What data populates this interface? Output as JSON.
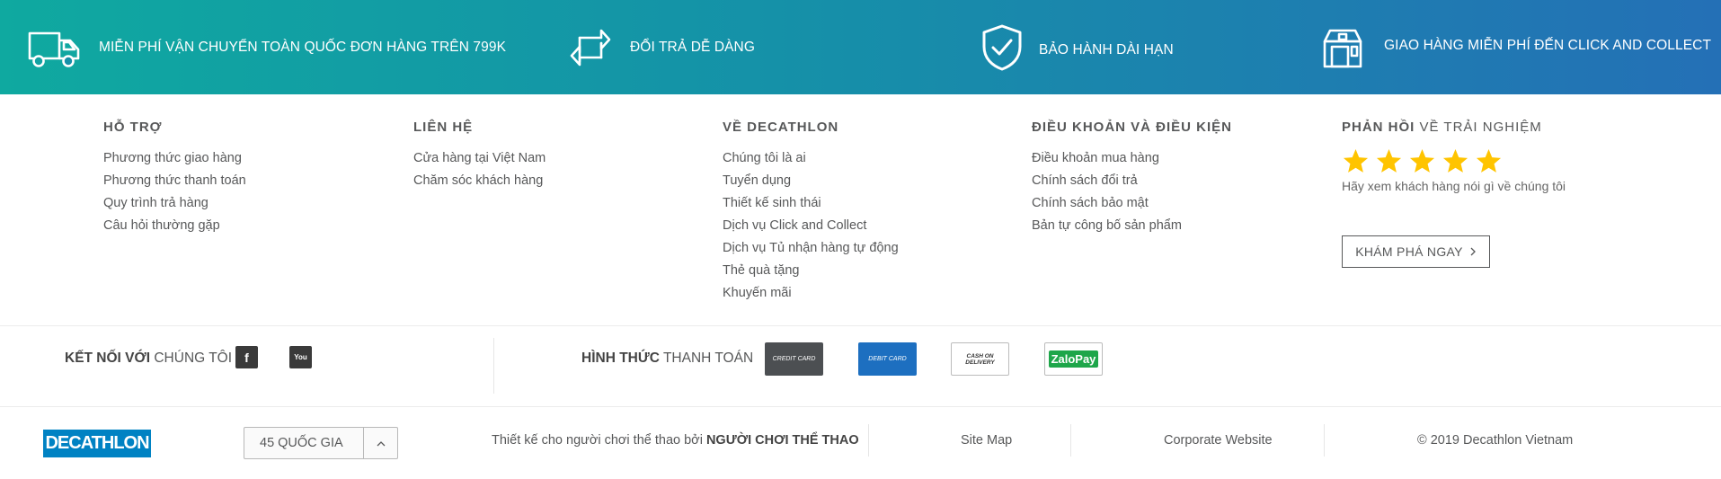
{
  "benefits": [
    {
      "icon": "truck-icon",
      "label": "MIỄN PHÍ VẬN CHUYỂN TOÀN QUỐC ĐƠN HÀNG TRÊN 799K"
    },
    {
      "icon": "exchange-icon",
      "label": "ĐỔI TRẢ DỄ DÀNG"
    },
    {
      "icon": "shield-check-icon",
      "label": "BẢO HÀNH DÀI HẠN"
    },
    {
      "icon": "store-icon",
      "label": "GIAO HÀNG MIỄN PHÍ ĐẾN CLICK AND COLLECT"
    }
  ],
  "columns": {
    "support": {
      "title": "HỖ TRỢ",
      "items": [
        "Phương thức giao hàng",
        "Phương thức thanh toán",
        "Quy trình trả hàng",
        "Câu hỏi thường gặp"
      ]
    },
    "contact": {
      "title": "LIÊN HỆ",
      "items": [
        "Cửa hàng tại Việt Nam",
        "Chăm sóc khách hàng"
      ]
    },
    "about": {
      "title": "VỀ DECATHLON",
      "items": [
        "Chúng tôi là ai",
        "Tuyển dụng",
        "Thiết kế sinh thái",
        "Dịch vụ Click and Collect",
        "Dịch vụ Tủ nhận hàng tự động",
        "Thẻ quà tặng",
        "Khuyến mãi"
      ]
    },
    "terms": {
      "title": "ĐIỀU KHOẢN VÀ ĐIỀU KIỆN",
      "items": [
        "Điều khoản mua hàng",
        "Chính sách đổi trả",
        "Chính sách bảo mật",
        "Bản tự công bố sản phẩm"
      ]
    },
    "feedback": {
      "title_bold": "PHẢN HỒI",
      "title_light": "VỀ TRẢI NGHIỆM",
      "rating": 5,
      "description": "Hãy xem khách hàng nói gì về chúng tôi",
      "button": "KHÁM PHÁ NGAY"
    }
  },
  "connect": {
    "label_bold": "KẾT NỐI VỚI",
    "label_light": "CHÚNG TÔI",
    "social": [
      {
        "icon": "facebook-icon",
        "glyph": "f"
      },
      {
        "icon": "youtube-icon",
        "glyph": "You"
      }
    ]
  },
  "payment": {
    "label_bold": "HÌNH THỨC",
    "label_light": "THANH TOÁN",
    "methods": [
      "CREDIT CARD",
      "DEBIT CARD",
      "CASH ON DELIVERY",
      "ZaloPay"
    ]
  },
  "bottom": {
    "logo": "DECATHLON",
    "country": "45 QUỐC GIA",
    "tagline_prefix": "Thiết kế cho người chơi thể thao bởi",
    "tagline_bold": "NGƯỜI CHƠI THỂ THAO",
    "sitemap": "Site Map",
    "corporate": "Corporate Website",
    "copyright": "© 2019 Decathlon Vietnam"
  },
  "colors": {
    "gradient_start": "#0fa9a0",
    "gradient_end": "#2470b6",
    "star": "#ffc400",
    "brand_blue": "#0082c3"
  }
}
